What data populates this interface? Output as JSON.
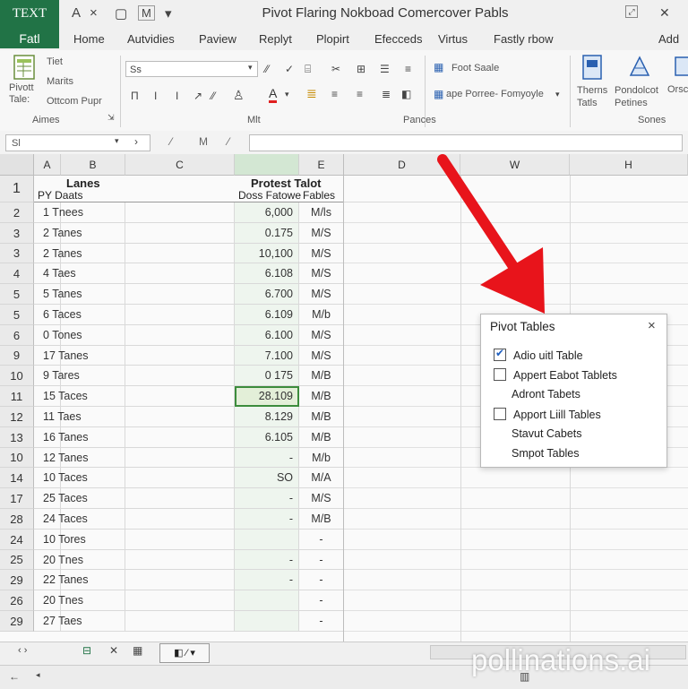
{
  "titlebar": {
    "app_badge": "TEXT",
    "quick_access": [
      "A",
      "×",
      "▢",
      "M",
      "▾"
    ],
    "doc_title": "Pivot Flaring Nokboad Comercover Pabls"
  },
  "tabs": {
    "file": "Fatl",
    "items": [
      "Home",
      "Autvidies",
      "Paview",
      "Replyt",
      "Plopirt",
      "Efecceds",
      "Virtus",
      "Fastly rbow"
    ],
    "add": "Add y"
  },
  "ribbon": {
    "pivot_label": "Pivott Tale:",
    "tiet": "Tiet",
    "marits": "Marits",
    "ottcom": "Ottcom Pupr",
    "font_box": "Ss",
    "foot_sale": "Foot Saale",
    "ape_porree": "ape Porree- Fomyoyle",
    "thems": "Therns Tatls",
    "pondolcot": "Pondolcot Petines",
    "orsc": "Orsc",
    "groups": [
      "Aimes",
      "Mlt",
      "Pances",
      "Sones"
    ]
  },
  "formulabar": {
    "namebox": "Sl"
  },
  "columns": [
    "A",
    "B",
    "C",
    "",
    "E",
    "D",
    "W",
    "H"
  ],
  "header_rows": {
    "row1": {
      "num": "1",
      "b": "Lanes",
      "protest": "Protest Talot"
    },
    "row2": {
      "b": "PY Daats",
      "d": "Doss Fatowe",
      "e": "Fables"
    }
  },
  "rows": [
    {
      "num": "2",
      "b": "1 Tnees",
      "d": "6,000",
      "e": "M/ls"
    },
    {
      "num": "3",
      "b": "2 Tanes",
      "d": "0.175",
      "e": "M/S"
    },
    {
      "num": "3",
      "b": "2 Tanes",
      "d": "10,100",
      "e": "M/S"
    },
    {
      "num": "4",
      "b": "4 Taes",
      "d": "6.108",
      "e": "M/S"
    },
    {
      "num": "5",
      "b": "5 Tanes",
      "d": "6.700",
      "e": "M/S"
    },
    {
      "num": "5",
      "b": "6 Taces",
      "d": "6.109",
      "e": "M/b"
    },
    {
      "num": "6",
      "b": "0 Tones",
      "d": "6.100",
      "e": "M/S"
    },
    {
      "num": "9",
      "b": "17 Tanes",
      "d": "7.100",
      "e": "M/S"
    },
    {
      "num": "10",
      "b": "9 Tares",
      "d": "0 175",
      "e": "M/B"
    },
    {
      "num": "11",
      "b": "15 Taces",
      "d": "28.109",
      "e": "M/B"
    },
    {
      "num": "12",
      "b": "11 Taes",
      "d": "8.129",
      "e": "M/B"
    },
    {
      "num": "13",
      "b": "16 Tanes",
      "d": "6.105",
      "e": "M/B"
    },
    {
      "num": "10",
      "b": "12 Tanes",
      "d": "-",
      "e": "M/b"
    },
    {
      "num": "14",
      "b": "10 Taces",
      "d": "SO",
      "e": "M/A"
    },
    {
      "num": "17",
      "b": "25 Taces",
      "d": "-",
      "e": "M/S"
    },
    {
      "num": "28",
      "b": "24 Taces",
      "d": "-",
      "e": "M/B"
    },
    {
      "num": "24",
      "b": "10 Tores",
      "d": "",
      "e": "-"
    },
    {
      "num": "25",
      "b": "20 Tnes",
      "d": "-",
      "e": "-"
    },
    {
      "num": "29",
      "b": "22 Tanes",
      "d": "-",
      "e": "-"
    },
    {
      "num": "26",
      "b": "20 Tnes",
      "d": "",
      "e": "-"
    },
    {
      "num": "29",
      "b": "27 Taes",
      "d": "",
      "e": "-"
    }
  ],
  "popup": {
    "title": "Pivot Tables",
    "close": "×",
    "items": [
      {
        "label": "Adio uitl Table",
        "checkbox": true,
        "checked": true
      },
      {
        "label": "Appert Eabot Tablets",
        "checkbox": true,
        "checked": false
      },
      {
        "label": "Adront Tabets",
        "checkbox": false,
        "checked": false
      },
      {
        "label": "Apport Liill Tables",
        "checkbox": true,
        "checked": false
      },
      {
        "label": "Stavut Cabets",
        "checkbox": false,
        "checked": false
      },
      {
        "label": "Smpot Tables",
        "checkbox": false,
        "checked": false
      }
    ]
  },
  "sheetbar": {
    "nav": "‹ ›",
    "sheet_icon_labels": [
      "⊟",
      "✕",
      "▦"
    ]
  },
  "watermark": "pollinations.ai",
  "colors": {
    "excel_green": "#217346",
    "arrow_red": "#e8141b",
    "selection_green": "#3c8c3c"
  }
}
